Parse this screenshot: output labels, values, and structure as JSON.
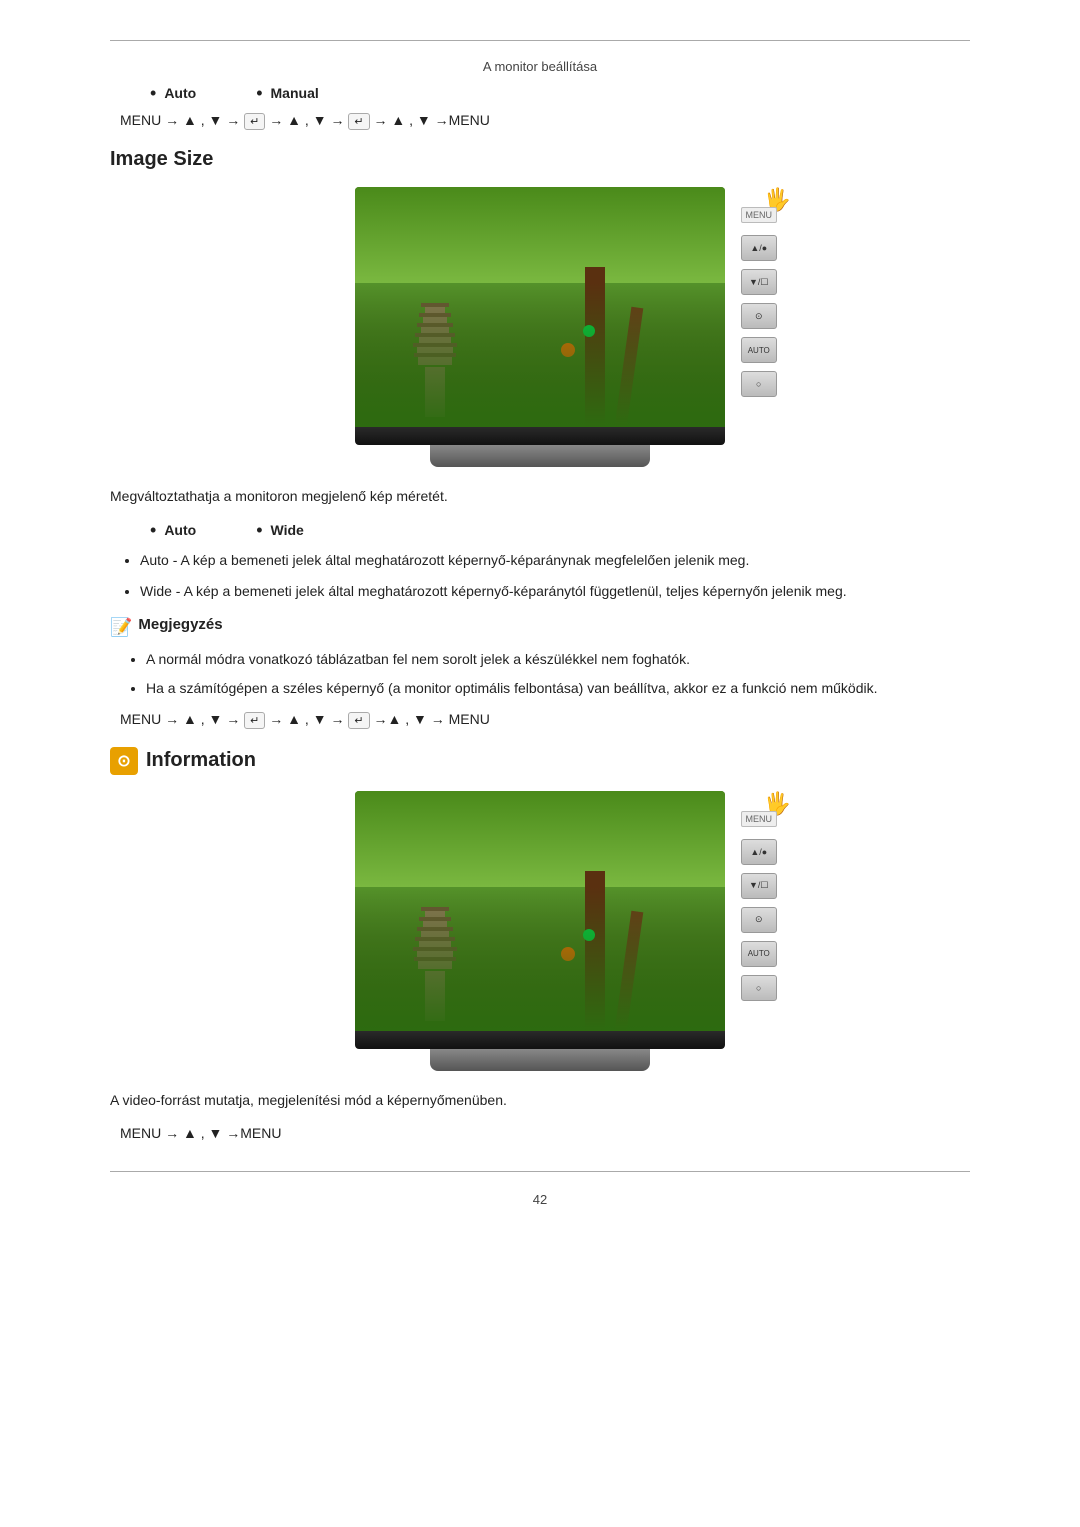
{
  "header": {
    "title": "A monitor beállítása"
  },
  "section1": {
    "bullets": [
      "Auto",
      "Manual"
    ],
    "nav1": "MENU → ▲ , ▼ → ↵ → ▲ , ▼ → ↵ → ▲ , ▼ →MENU"
  },
  "image_size": {
    "title": "Image Size",
    "description": "Megváltoztathatja a monitoron megjelenő kép méretét.",
    "bullets": [
      "Auto",
      "Wide"
    ],
    "auto_desc": "Auto - A kép a bemeneti jelek által meghatározott képernyő-képaránynak megfelelően jelenik meg.",
    "wide_desc": "Wide - A kép a bemeneti jelek által meghatározott képernyő-képaránytól függetlenül, teljes képernyőn jelenik meg.",
    "note_title": "Megjegyzés",
    "note1": "A normál módra vonatkozó táblázatban fel nem sorolt jelek a készülékkel nem foghatók.",
    "note2": "Ha a számítógépen a széles képernyő (a monitor optimális felbontása) van beállítva, akkor ez a funkció nem működik.",
    "nav2": "MENU → ▲ , ▼ → ↵ → ▲ , ▼ → ↵ →▲ , ▼ → MENU"
  },
  "information": {
    "title": "Information",
    "icon_symbol": "⊙",
    "description": "A video-forrást mutatja, megjelenítési mód a képernyőmenüben.",
    "nav": "MENU → ▲ , ▼ →MENU"
  },
  "footer": {
    "page_number": "42"
  }
}
